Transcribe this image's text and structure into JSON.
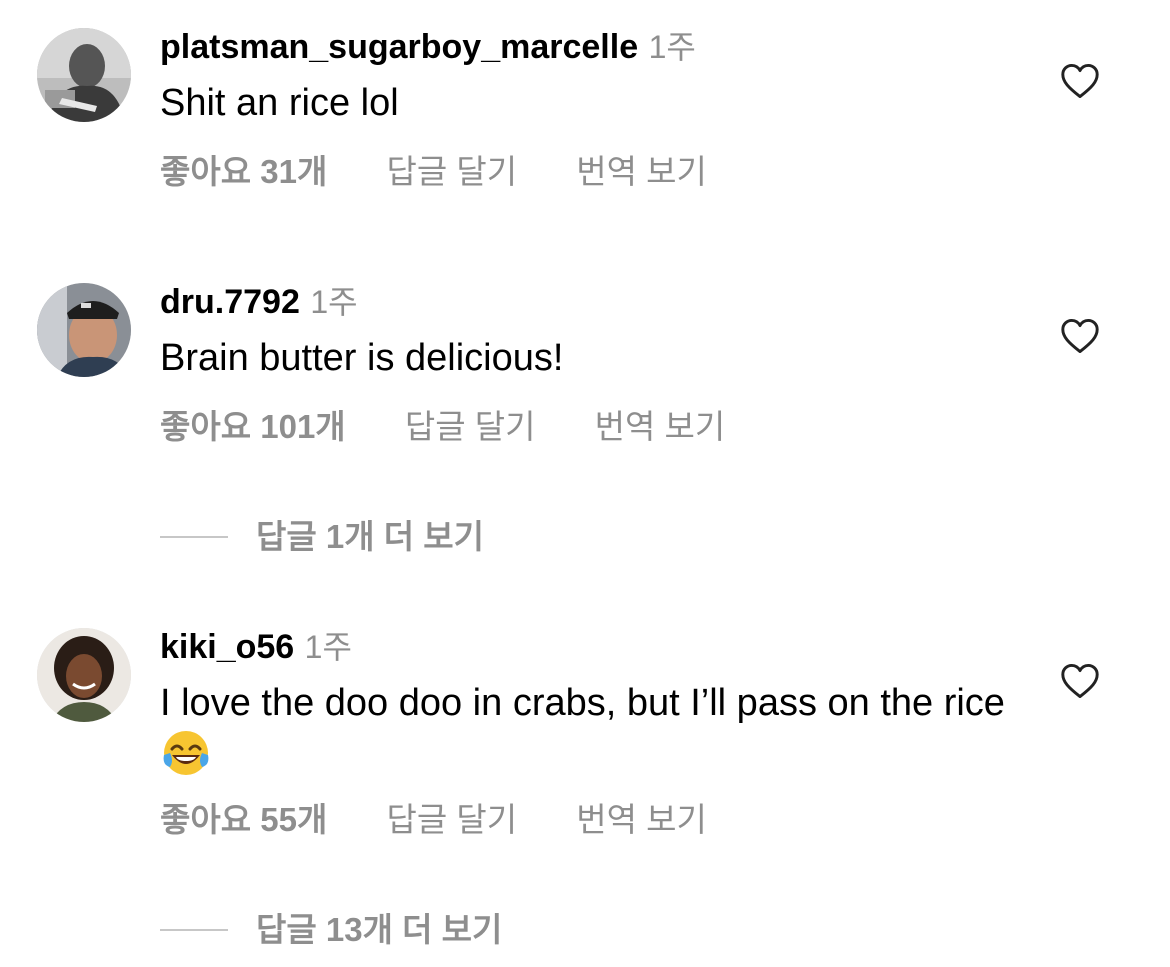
{
  "comments": [
    {
      "username": "platsman_sugarboy_marcelle",
      "time": "1주",
      "text": "Shit an rice lol",
      "likes": "좋아요 31개",
      "reply": "답글 달기",
      "translate": "번역 보기",
      "avatar_icon": "avatar-grayscale-man"
    },
    {
      "username": "dru.7792",
      "time": "1주",
      "text": "Brain butter is delicious!",
      "likes": "좋아요 101개",
      "reply": "답글 달기",
      "translate": "번역 보기",
      "view_replies": "답글 1개 더 보기",
      "avatar_icon": "avatar-man-cap"
    },
    {
      "username": "kiki_o56",
      "time": "1주",
      "text": "I love the doo doo in crabs, but I’ll pass on the rice",
      "emoji": "😂",
      "likes": "좋아요 55개",
      "reply": "답글 달기",
      "translate": "번역 보기",
      "view_replies": "답글 13개 더 보기",
      "avatar_icon": "avatar-woman-curly-hair"
    }
  ],
  "colors": {
    "primary_text": "#000000",
    "secondary_text": "#8e8e8e",
    "divider": "#c7c7c7",
    "background": "#ffffff"
  }
}
